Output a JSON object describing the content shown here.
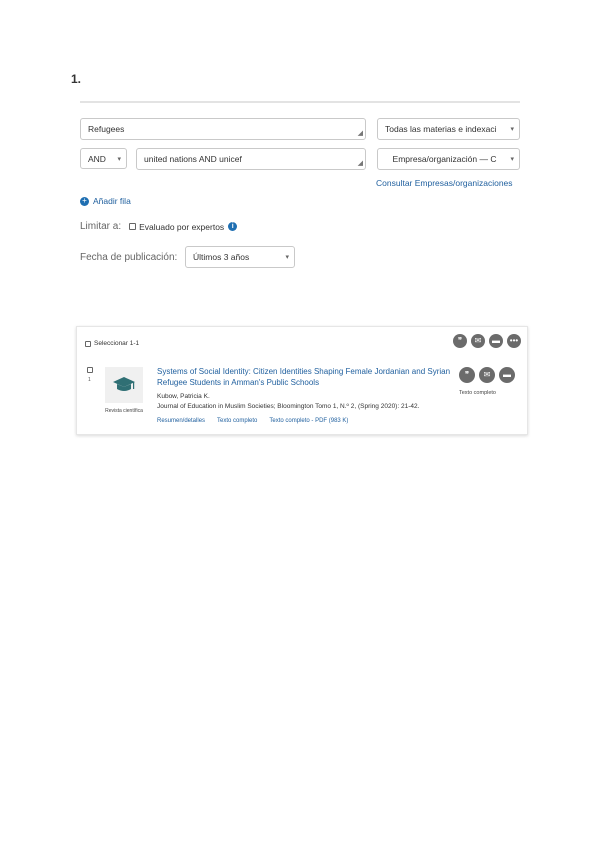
{
  "step_number": "1.",
  "search": {
    "row1": {
      "term": "Refugees",
      "field": "Todas las materias e indexaci"
    },
    "row2": {
      "operator": "AND",
      "term": "united nations AND unicef",
      "field": "Empresa/organización — C"
    },
    "consult_link": "Consultar Empresas/organizaciones",
    "add_row": "Añadir fila"
  },
  "limit": {
    "label": "Limitar a:",
    "peer_reviewed": "Evaluado por expertos",
    "info_icon": "i"
  },
  "date": {
    "label": "Fecha de publicación:",
    "selected": "Últimos 3 años"
  },
  "results": {
    "select_label": "Seleccionar 1-1",
    "toolbar_icons": [
      "quote-icon",
      "email-icon",
      "save-icon",
      "more-icon"
    ],
    "items": [
      {
        "index": "1",
        "thumb_label": "Revista científica",
        "title": "Systems of Social Identity: Citizen Identities Shaping Female Jordanian and Syrian Refugee Students in Amman's Public Schools",
        "author": "Kubow, Patricia K.",
        "source": "Journal of Education in Muslim Societies; Bloomington Tomo 1, N.º 2, (Spring 2020): 21-42.",
        "links": [
          "Resumen/detalles",
          "Texto completo",
          "Texto completo - PDF (983 K)"
        ],
        "fulltext_label": "Texto completo"
      }
    ]
  },
  "colors": {
    "link": "#1f5f9e",
    "icon_gray": "#6b6b6b",
    "thumb_teal": "#2f6f74",
    "info_blue": "#1f6fb2"
  }
}
